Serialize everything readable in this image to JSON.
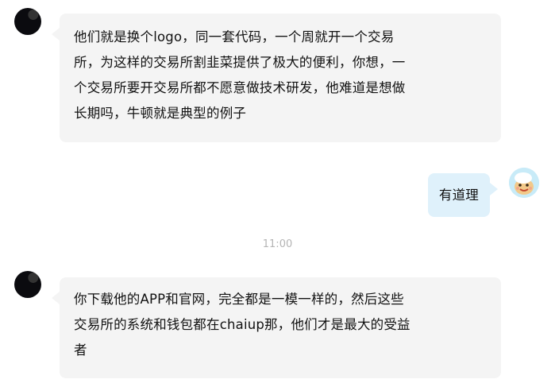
{
  "messages": [
    {
      "side": "left",
      "lines": [
        "他们就是换个logo，同一套代码，一个周就开一个交易",
        "所，为这样的交易所割韭菜提供了极大的便利，你想，一",
        "个交易所要开交易所都不愿意做技术研发，他难道是想做",
        "长期吗，牛顿就是典型的例子"
      ]
    },
    {
      "side": "right",
      "text": "有道理"
    },
    {
      "side": "left",
      "lines": [
        "你下载他的APP和官网，完全都是一模一样的，然后这些",
        "交易所的系统和钱包都在chaiup那，他们才是最大的受益",
        "者"
      ]
    }
  ],
  "timestamp": "11:00",
  "colors": {
    "left_bubble": "#f4f4f4",
    "right_bubble": "#dff1fb",
    "timestamp_text": "#b5b5b5"
  }
}
